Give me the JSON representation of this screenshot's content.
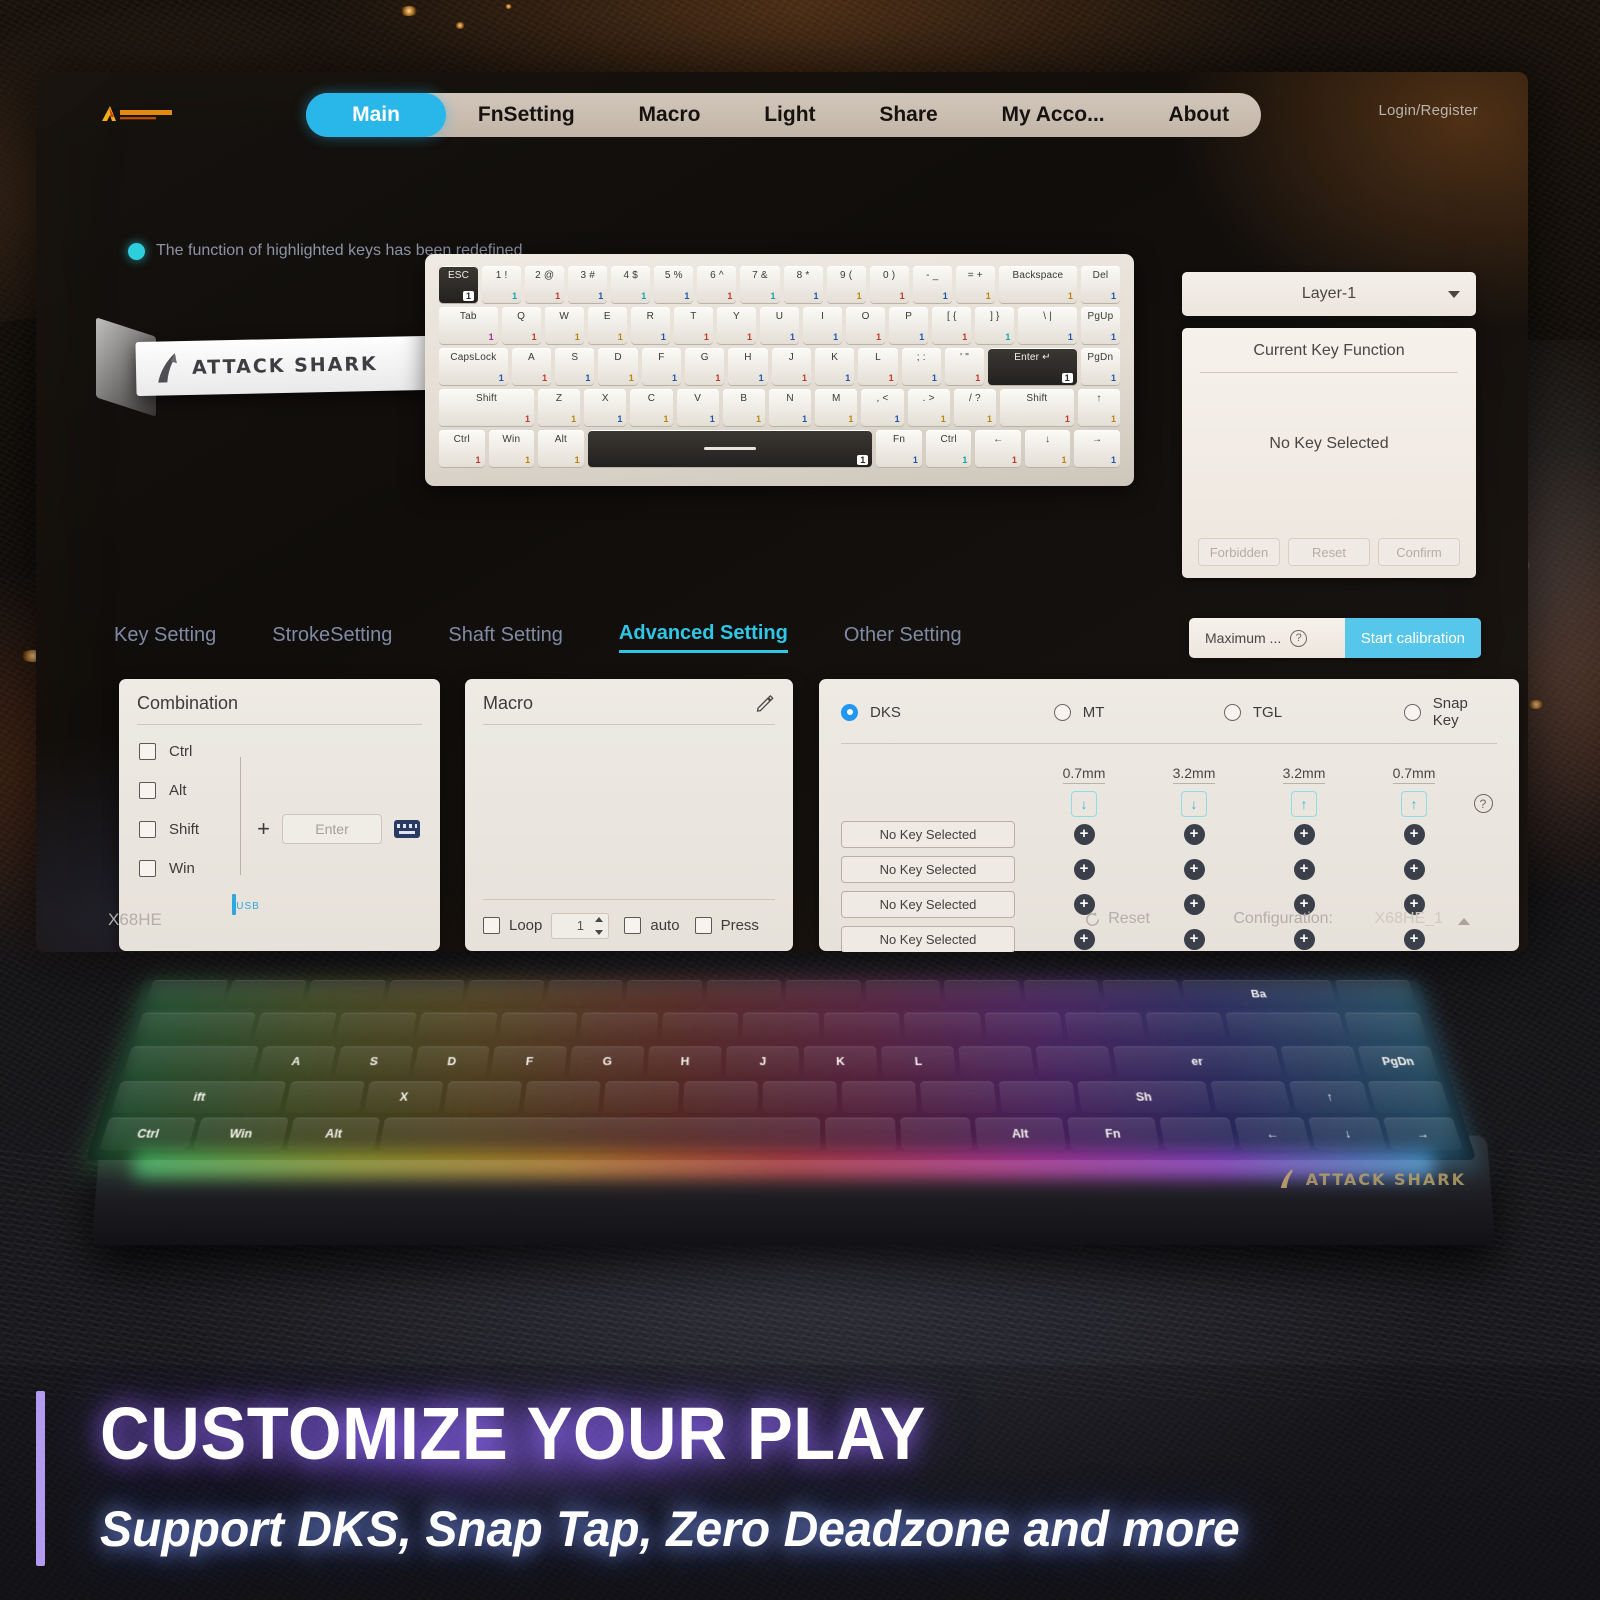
{
  "app": {
    "brand_name": "ATTACK SHARK",
    "login_label": "Login/Register",
    "nav_tabs": [
      {
        "label": "Main",
        "active": true
      },
      {
        "label": "FnSetting",
        "active": false
      },
      {
        "label": "Macro",
        "active": false
      },
      {
        "label": "Light",
        "active": false
      },
      {
        "label": "Share",
        "active": false
      },
      {
        "label": "My Acco...",
        "active": false
      },
      {
        "label": "About",
        "active": false
      }
    ],
    "notice": "The function of highlighted keys has been redefined",
    "notice_dot_color": "#2ecfdd",
    "accent_color": "#29b6e8"
  },
  "layer": {
    "selected": "Layer-1",
    "caret_icon": "chevron-down-icon"
  },
  "key_function": {
    "title": "Current Key Function",
    "value": "No Key Selected",
    "buttons": [
      "Forbidden",
      "Reset",
      "Confirm"
    ]
  },
  "setting_tabs": [
    {
      "label": "Key Setting",
      "active": false
    },
    {
      "label": "StrokeSetting",
      "active": false
    },
    {
      "label": "Shaft Setting",
      "active": false
    },
    {
      "label": "Advanced Setting",
      "active": true
    },
    {
      "label": "Other Setting",
      "active": false
    }
  ],
  "calibration": {
    "label": "Maximum ...",
    "help_icon": "question-mark-icon",
    "button_label": "Start calibration",
    "button_color": "#56c6eb"
  },
  "combination": {
    "title": "Combination",
    "modifiers": [
      "Ctrl",
      "Alt",
      "Shift",
      "Win"
    ],
    "plus": "+",
    "input_placeholder": "Enter",
    "keyboard_icon": "keyboard-icon"
  },
  "macro": {
    "title": "Macro",
    "edit_icon": "pencil-icon",
    "loop_label": "Loop",
    "loop_count": "1",
    "auto_label": "auto",
    "press_label": "Press"
  },
  "dks": {
    "modes": [
      {
        "label": "DKS",
        "selected": true
      },
      {
        "label": "MT",
        "selected": false
      },
      {
        "label": "TGL",
        "selected": false
      },
      {
        "label": "Snap Key",
        "selected": false
      }
    ],
    "columns": [
      {
        "depth": "0.7mm",
        "direction": "down",
        "icon": "arrow-down-icon"
      },
      {
        "depth": "3.2mm",
        "direction": "down",
        "icon": "arrow-down-icon"
      },
      {
        "depth": "3.2mm",
        "direction": "up",
        "icon": "arrow-up-icon"
      },
      {
        "depth": "0.7mm",
        "direction": "up",
        "icon": "arrow-up-icon"
      }
    ],
    "help_icon": "question-mark-icon",
    "rows": [
      {
        "key": "No Key Selected",
        "actions": [
          "+",
          "+",
          "+",
          "+"
        ]
      },
      {
        "key": "No Key Selected",
        "actions": [
          "+",
          "+",
          "+",
          "+"
        ]
      },
      {
        "key": "No Key Selected",
        "actions": [
          "+",
          "+",
          "+",
          "+"
        ]
      },
      {
        "key": "No Key Selected",
        "actions": [
          "+",
          "+",
          "+",
          "+"
        ]
      }
    ]
  },
  "status_bar": {
    "model": "X68HE",
    "connection_icon": "keyboard-usb-icon",
    "connection_label": "USB",
    "reset_icon": "refresh-icon",
    "reset_label": "Reset",
    "configuration_label": "Configuration:",
    "configuration_value": "X68HE_1",
    "caret_icon": "chevron-up-icon"
  },
  "virtual_keyboard": {
    "layer_badge": "1",
    "rows": [
      [
        {
          "label": "ESC",
          "layer": "1",
          "dark": true,
          "w": "w1"
        },
        {
          "label": "1 !",
          "layer": "1",
          "color": "c-cyan",
          "w": "w1"
        },
        {
          "label": "2 @",
          "layer": "1",
          "color": "c-red",
          "w": "w1"
        },
        {
          "label": "3 #",
          "layer": "1",
          "color": "c-blue",
          "w": "w1"
        },
        {
          "label": "4 $",
          "layer": "1",
          "color": "c-cyan",
          "w": "w1"
        },
        {
          "label": "5 %",
          "layer": "1",
          "color": "c-blue",
          "w": "w1"
        },
        {
          "label": "6 ^",
          "layer": "1",
          "color": "c-red",
          "w": "w1"
        },
        {
          "label": "7 &",
          "layer": "1",
          "color": "c-cyan",
          "w": "w1"
        },
        {
          "label": "8 *",
          "layer": "1",
          "color": "c-blue",
          "w": "w1"
        },
        {
          "label": "9 (",
          "layer": "1",
          "color": "c-gold",
          "w": "w1"
        },
        {
          "label": "0 )",
          "layer": "1",
          "color": "c-red",
          "w": "w1"
        },
        {
          "label": "- _",
          "layer": "1",
          "color": "c-blue",
          "w": "w1"
        },
        {
          "label": "= +",
          "layer": "1",
          "color": "c-gold",
          "w": "w1"
        },
        {
          "label": "Backspace",
          "layer": "1",
          "color": "c-gold",
          "w": "w2"
        },
        {
          "label": "Del",
          "layer": "1",
          "color": "c-blue",
          "w": "w1"
        }
      ],
      [
        {
          "label": "Tab",
          "layer": "1",
          "color": "c-mag",
          "w": "w15"
        },
        {
          "label": "Q",
          "layer": "1",
          "color": "c-red",
          "w": "w1"
        },
        {
          "label": "W",
          "layer": "1",
          "color": "c-gold",
          "w": "w1"
        },
        {
          "label": "E",
          "layer": "1",
          "color": "c-gold",
          "w": "w1"
        },
        {
          "label": "R",
          "layer": "1",
          "color": "c-blue",
          "w": "w1"
        },
        {
          "label": "T",
          "layer": "1",
          "color": "c-red",
          "w": "w1"
        },
        {
          "label": "Y",
          "layer": "1",
          "color": "c-red",
          "w": "w1"
        },
        {
          "label": "U",
          "layer": "1",
          "color": "c-blue",
          "w": "w1"
        },
        {
          "label": "I",
          "layer": "1",
          "color": "c-blue",
          "w": "w1"
        },
        {
          "label": "O",
          "layer": "1",
          "color": "c-red",
          "w": "w1"
        },
        {
          "label": "P",
          "layer": "1",
          "color": "c-blue",
          "w": "w1"
        },
        {
          "label": "[ {",
          "layer": "1",
          "color": "c-red",
          "w": "w1"
        },
        {
          "label": "] }",
          "layer": "1",
          "color": "c-cyan",
          "w": "w1"
        },
        {
          "label": "\\ |",
          "layer": "1",
          "color": "c-blue",
          "w": "w15"
        },
        {
          "label": "PgUp",
          "layer": "1",
          "color": "c-blue",
          "w": "w1"
        }
      ],
      [
        {
          "label": "CapsLock",
          "layer": "1",
          "color": "c-blue",
          "w": "w175"
        },
        {
          "label": "A",
          "layer": "1",
          "color": "c-red",
          "w": "w1"
        },
        {
          "label": "S",
          "layer": "1",
          "color": "c-blue",
          "w": "w1"
        },
        {
          "label": "D",
          "layer": "1",
          "color": "c-gold",
          "w": "w1"
        },
        {
          "label": "F",
          "layer": "1",
          "color": "c-blue",
          "w": "w1"
        },
        {
          "label": "G",
          "layer": "1",
          "color": "c-red",
          "w": "w1"
        },
        {
          "label": "H",
          "layer": "1",
          "color": "c-blue",
          "w": "w1"
        },
        {
          "label": "J",
          "layer": "1",
          "color": "c-red",
          "w": "w1"
        },
        {
          "label": "K",
          "layer": "1",
          "color": "c-blue",
          "w": "w1"
        },
        {
          "label": "L",
          "layer": "1",
          "color": "c-red",
          "w": "w1"
        },
        {
          "label": "; :",
          "layer": "1",
          "color": "c-blue",
          "w": "w1"
        },
        {
          "label": "' \"",
          "layer": "1",
          "color": "c-red",
          "w": "w1"
        },
        {
          "label": "Enter",
          "layer": "1",
          "dark": true,
          "w": "w225"
        },
        {
          "label": "PgDn",
          "layer": "1",
          "color": "c-blue",
          "w": "w1"
        }
      ],
      [
        {
          "label": "Shift",
          "layer": "1",
          "color": "c-red",
          "w": "w225"
        },
        {
          "label": "Z",
          "layer": "1",
          "color": "c-gold",
          "w": "w1"
        },
        {
          "label": "X",
          "layer": "1",
          "color": "c-blue",
          "w": "w1"
        },
        {
          "label": "C",
          "layer": "1",
          "color": "c-gold",
          "w": "w1"
        },
        {
          "label": "V",
          "layer": "1",
          "color": "c-blue",
          "w": "w1"
        },
        {
          "label": "B",
          "layer": "1",
          "color": "c-gold",
          "w": "w1"
        },
        {
          "label": "N",
          "layer": "1",
          "color": "c-blue",
          "w": "w1"
        },
        {
          "label": "M",
          "layer": "1",
          "color": "c-gold",
          "w": "w1"
        },
        {
          "label": ", <",
          "layer": "1",
          "color": "c-blue",
          "w": "w1"
        },
        {
          "label": ". >",
          "layer": "1",
          "color": "c-gold",
          "w": "w1"
        },
        {
          "label": "/ ?",
          "layer": "1",
          "color": "c-gold",
          "w": "w1"
        },
        {
          "label": "Shift",
          "layer": "1",
          "color": "c-red",
          "w": "w175"
        },
        {
          "label": "↑",
          "layer": "1",
          "color": "c-gold",
          "w": "w1"
        }
      ],
      [
        {
          "label": "Ctrl",
          "layer": "1",
          "color": "c-red",
          "w": "w1"
        },
        {
          "label": "Win",
          "layer": "1",
          "color": "c-gold",
          "w": "w1"
        },
        {
          "label": "Alt",
          "layer": "1",
          "color": "c-gold",
          "w": "w1"
        },
        {
          "label": "",
          "layer": "1",
          "dark": true,
          "space": true,
          "w": "w625"
        },
        {
          "label": "Fn",
          "layer": "1",
          "color": "c-blue",
          "w": "w1"
        },
        {
          "label": "Ctrl",
          "layer": "1",
          "color": "c-cyan",
          "w": "w1"
        },
        {
          "label": "←",
          "layer": "1",
          "color": "c-red",
          "w": "w1"
        },
        {
          "label": "↓",
          "layer": "1",
          "color": "c-gold",
          "w": "w1"
        },
        {
          "label": "→",
          "layer": "1",
          "color": "c-blue",
          "w": "w1"
        }
      ]
    ]
  },
  "physical_keyboard": {
    "brand": "ATTACK SHARK",
    "visible_keys": [
      "A",
      "S",
      "D",
      "F",
      "G",
      "H",
      "J",
      "K",
      "L",
      "Ctrl",
      "Win",
      "Alt",
      "Alt",
      "Fn",
      "Sh",
      "PgDn",
      "←",
      "↓",
      "→",
      "↑",
      "Ba"
    ]
  },
  "caption": {
    "headline": "CUSTOMIZE YOUR PLAY",
    "subline": "Support DKS, Snap Tap, Zero Deadzone and more",
    "bar_color": "#b39bf0"
  }
}
